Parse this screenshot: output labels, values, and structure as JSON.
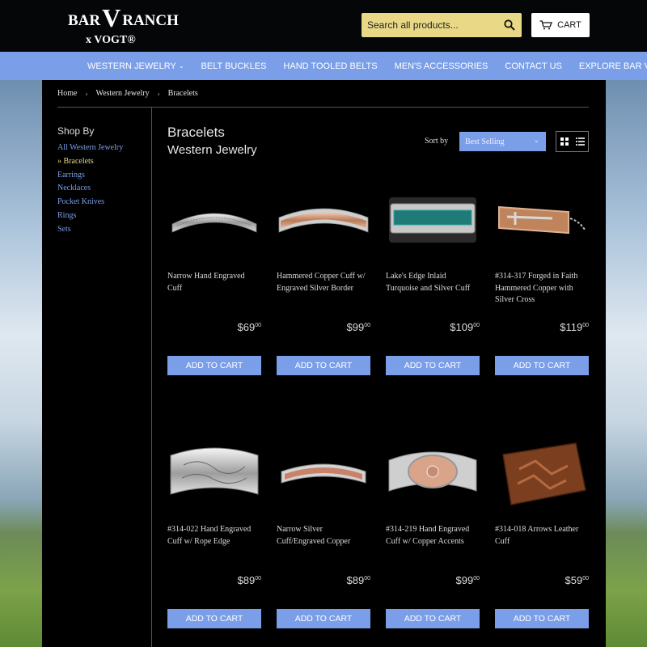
{
  "brand": {
    "logo_line1a": "BAR",
    "logo_v": "V",
    "logo_line1b": "RANCH",
    "logo_line2": "x VOGT®"
  },
  "search": {
    "placeholder": "Search all products..."
  },
  "cart": {
    "label": "CART"
  },
  "nav": {
    "items": [
      {
        "label": "WESTERN JEWELRY",
        "dropdown": true
      },
      {
        "label": "BELT BUCKLES",
        "dropdown": false
      },
      {
        "label": "HAND TOOLED BELTS",
        "dropdown": false
      },
      {
        "label": "MEN'S ACCESSORIES",
        "dropdown": false
      },
      {
        "label": "CONTACT US",
        "dropdown": false
      },
      {
        "label": "EXPLORE BAR V",
        "dropdown": true
      }
    ]
  },
  "breadcrumb": [
    "Home",
    "Western Jewelry",
    "Bracelets"
  ],
  "breadcrumb_separator": "›",
  "sidebar": {
    "title": "Shop By",
    "items": [
      {
        "label": "All Western Jewelry",
        "active": false
      },
      {
        "label": "» Bracelets",
        "active": true
      },
      {
        "label": "Earrings",
        "active": false
      },
      {
        "label": "Necklaces",
        "active": false
      },
      {
        "label": "Pocket Knives",
        "active": false
      },
      {
        "label": "Rings",
        "active": false
      },
      {
        "label": "Sets",
        "active": false
      }
    ]
  },
  "collection": {
    "title": "Bracelets",
    "subtitle": "Western Jewelry"
  },
  "sort": {
    "label": "Sort by",
    "selected": "Best Selling"
  },
  "products": [
    {
      "name": "Narrow Hand Engraved Cuff",
      "price_main": "$69",
      "price_cents": "00",
      "button": "ADD TO CART",
      "image": "silver-engraved-cuff"
    },
    {
      "name": "Hammered Copper Cuff w/ Engraved Silver Border",
      "price_main": "$99",
      "price_cents": "00",
      "button": "ADD TO CART",
      "image": "copper-silver-cuff"
    },
    {
      "name": "Lake's Edge Inlaid Turquoise and Silver Cuff",
      "price_main": "$109",
      "price_cents": "00",
      "button": "ADD TO CART",
      "image": "turquoise-cuff"
    },
    {
      "name": "#314-317 Forged in Faith Hammered Copper with Silver Cross",
      "price_main": "$119",
      "price_cents": "00",
      "button": "ADD TO CART",
      "image": "copper-cross-cuff"
    },
    {
      "name": "#314-022 Hand Engraved Cuff w/ Rope Edge",
      "price_main": "$89",
      "price_cents": "00",
      "button": "ADD TO CART",
      "image": "wide-silver-cuff"
    },
    {
      "name": "Narrow Silver Cuff/Engraved Copper",
      "price_main": "$89",
      "price_cents": "00",
      "button": "ADD TO CART",
      "image": "narrow-copper-cuff"
    },
    {
      "name": "#314-219 Hand Engraved Cuff w/ Copper Accents",
      "price_main": "$99",
      "price_cents": "00",
      "button": "ADD TO CART",
      "image": "copper-accent-cuff"
    },
    {
      "name": "#314-018 Arrows Leather Cuff",
      "price_main": "$59",
      "price_cents": "00",
      "button": "ADD TO CART",
      "image": "leather-cuff"
    }
  ],
  "colors": {
    "accent": "#7b9ee8",
    "search_bg": "#e9d987",
    "active_link": "#e9d987",
    "panel_bg": "#000000"
  }
}
